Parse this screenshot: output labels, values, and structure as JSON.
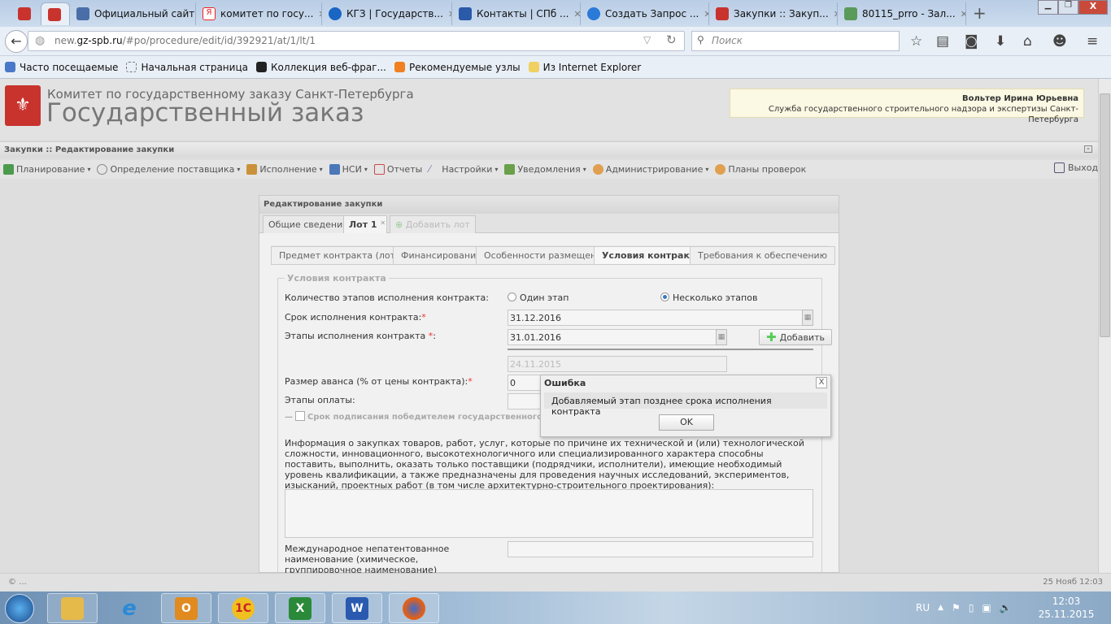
{
  "browser": {
    "tabs": [
      {
        "title": "",
        "icon": "spb-crest",
        "color": "#c8332e"
      },
      {
        "title": "",
        "icon": "gavel",
        "color": "#c8332e",
        "active": true
      },
      {
        "title": "Официальный сайт ...",
        "icon": "doc",
        "color": "#4a6ea8"
      },
      {
        "title": "комитет по госу...",
        "icon": "yandex",
        "color": "#e22"
      },
      {
        "title": "КГЗ | Государств...",
        "icon": "kgz",
        "color": "#1a66c4"
      },
      {
        "title": "Контакты | СПб ...",
        "icon": "imc",
        "color": "#2a5aa8"
      },
      {
        "title": "Создать Запрос ...",
        "icon": "help",
        "color": "#2a7ad8"
      },
      {
        "title": "Закупки :: Закуп...",
        "icon": "gavel",
        "color": "#c8332e"
      },
      {
        "title": "80115_prro - Зал...",
        "icon": "image",
        "color": "#5a9a5a"
      }
    ],
    "new_tab": "+",
    "url_prefix": "new.",
    "url_domain": "gz-spb.ru",
    "url_path": "/#po/procedure/edit/id/392921/at/1/lt/1",
    "search_placeholder": "Поиск",
    "bookmarks": [
      "Часто посещаемые",
      "Начальная страница",
      "Коллекция веб-фраг...",
      "Рекомендуемые узлы",
      "Из Internet Explorer"
    ]
  },
  "header": {
    "org": "Комитет по государственному заказу Санкт-Петербурга",
    "app": "Государственный заказ",
    "user_name": "Вольтер Ирина Юрьевна",
    "user_org": "Служба государственного строительного надзора и экспертизы Санкт-Петербурга"
  },
  "title_bar": "Закупки :: Редактирование закупки",
  "menu": [
    {
      "label": "Планирование",
      "dropdown": true,
      "color": "#4c9a4c"
    },
    {
      "label": "Определение поставщика",
      "dropdown": true,
      "color": "#888"
    },
    {
      "label": "Исполнение",
      "dropdown": true,
      "color": "#c9923a"
    },
    {
      "label": "НСИ",
      "dropdown": true,
      "color": "#4a78b8"
    },
    {
      "label": "Отчеты",
      "dropdown": false,
      "color": "#c94a4a"
    },
    {
      "label": "Настройки",
      "dropdown": true,
      "color": "#7a8aa8"
    },
    {
      "label": "Уведомления",
      "dropdown": true,
      "color": "#6aa04a"
    },
    {
      "label": "Администрирование",
      "dropdown": true,
      "color": "#e0a050"
    },
    {
      "label": "Планы проверок",
      "dropdown": false,
      "color": "#e0a050"
    }
  ],
  "exit_label": "Выход",
  "panel": {
    "title": "Редактирование закупки",
    "tabs": [
      "Общие сведения",
      "Лот 1",
      "Добавить лот"
    ],
    "subtabs": [
      "Предмет контракта (лота)",
      "Финансирование",
      "Особенности размещения",
      "Условия контракта",
      "Требования к обеспечению"
    ],
    "active_subtab": "Условия контракта",
    "fieldset": "Условия контракта",
    "stages_label": "Количество этапов исполнения контракта:",
    "radio_one": "Один этап",
    "radio_many": "Несколько этапов",
    "stages_selected": "Несколько этапов",
    "term_label": "Срок исполнения контракта:",
    "term_value": "31.12.2016",
    "stage_label": "Этапы исполнения контракта ",
    "stage_value": "31.01.2016",
    "add_label": "Добавить",
    "stage_disabled_value": "24.11.2015",
    "advance_label": "Размер аванса (% от цены контракта):",
    "advance_value": "0",
    "payment_label": "Этапы оплаты:",
    "signing_label": "Срок подписания победителем государственного контр",
    "info_label": "Информация о закупках товаров, работ, услуг, которые по причине их технической и (или) технологической сложности, инновационного, высокотехнологичного или специализированного характера способны поставить, выполнить, оказать только поставщики (подрядчики, исполнители), имеющие необходимый уровень квалификации, а также предназначены для проведения научных исследований, экспериментов, изысканий, проектных работ (в том числе архитектурно-строительного проектирования):",
    "inn_label": "Международное непатентованное наименование (химическое, группировочное наименование) лекарственного средства:"
  },
  "dialog": {
    "title": "Ошибка",
    "message": "Добавляемый этап позднее срока исполнения контракта",
    "ok": "OK"
  },
  "status": {
    "left": "© ...",
    "right": "25 Нояб 12:03"
  },
  "taskbar": {
    "apps": [
      {
        "name": "explorer",
        "label": "",
        "color": "#e5b94a"
      },
      {
        "name": "ie",
        "label": "e",
        "color": "#2a8ad8"
      },
      {
        "name": "outlook",
        "label": "O",
        "color": "#e08a20"
      },
      {
        "name": "1c",
        "label": "1С",
        "color": "#f0c020"
      },
      {
        "name": "excel",
        "label": "X",
        "color": "#2a8a3a"
      },
      {
        "name": "word",
        "label": "W",
        "color": "#2a5ab0"
      },
      {
        "name": "firefox",
        "label": "",
        "color": "#e0601a"
      }
    ],
    "lang": "RU",
    "time": "12:03",
    "date": "25.11.2015"
  }
}
